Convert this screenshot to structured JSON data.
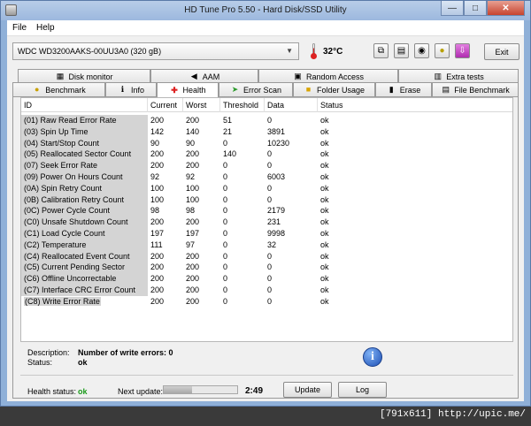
{
  "window": {
    "title": "HD Tune Pro 5.50 - Hard Disk/SSD Utility",
    "min_label": "—",
    "max_label": "□",
    "close_label": "✕"
  },
  "menu": [
    "File",
    "Help"
  ],
  "toolbar": {
    "drive": "WDC WD3200AAKS-00UU3A0 (320 gB)",
    "temperature": "32°C",
    "exit_label": "Exit",
    "icons": [
      "copy-icon",
      "save-icon",
      "camera-icon",
      "options-icon",
      "download-icon"
    ]
  },
  "tabs_top": [
    {
      "label": "Disk monitor",
      "icon": "disk-monitor-icon"
    },
    {
      "label": "AAM",
      "icon": "speaker-icon"
    },
    {
      "label": "Random Access",
      "icon": "random-access-icon"
    },
    {
      "label": "Extra tests",
      "icon": "extra-tests-icon"
    }
  ],
  "tabs_bottom": [
    {
      "label": "Benchmark",
      "icon": "benchmark-icon"
    },
    {
      "label": "Info",
      "icon": "info-tab-icon"
    },
    {
      "label": "Health",
      "icon": "health-icon"
    },
    {
      "label": "Error Scan",
      "icon": "error-scan-icon"
    },
    {
      "label": "Folder Usage",
      "icon": "folder-icon"
    },
    {
      "label": "Erase",
      "icon": "erase-icon"
    },
    {
      "label": "File Benchmark",
      "icon": "file-benchmark-icon"
    }
  ],
  "active_tab": "Health",
  "table": {
    "headers": [
      "ID",
      "Current",
      "Worst",
      "Threshold",
      "Data",
      "Status"
    ],
    "rows": [
      [
        "(01) Raw Read Error Rate",
        "200",
        "200",
        "51",
        "0",
        "ok"
      ],
      [
        "(03) Spin Up Time",
        "142",
        "140",
        "21",
        "3891",
        "ok"
      ],
      [
        "(04) Start/Stop Count",
        "90",
        "90",
        "0",
        "10230",
        "ok"
      ],
      [
        "(05) Reallocated Sector Count",
        "200",
        "200",
        "140",
        "0",
        "ok"
      ],
      [
        "(07) Seek Error Rate",
        "200",
        "200",
        "0",
        "0",
        "ok"
      ],
      [
        "(09) Power On Hours Count",
        "92",
        "92",
        "0",
        "6003",
        "ok"
      ],
      [
        "(0A) Spin Retry Count",
        "100",
        "100",
        "0",
        "0",
        "ok"
      ],
      [
        "(0B) Calibration Retry Count",
        "100",
        "100",
        "0",
        "0",
        "ok"
      ],
      [
        "(0C) Power Cycle Count",
        "98",
        "98",
        "0",
        "2179",
        "ok"
      ],
      [
        "(C0) Unsafe Shutdown Count",
        "200",
        "200",
        "0",
        "231",
        "ok"
      ],
      [
        "(C1) Load Cycle Count",
        "197",
        "197",
        "0",
        "9998",
        "ok"
      ],
      [
        "(C2) Temperature",
        "111",
        "97",
        "0",
        "32",
        "ok"
      ],
      [
        "(C4) Reallocated Event Count",
        "200",
        "200",
        "0",
        "0",
        "ok"
      ],
      [
        "(C5) Current Pending Sector",
        "200",
        "200",
        "0",
        "0",
        "ok"
      ],
      [
        "(C6) Offline Uncorrectable",
        "200",
        "200",
        "0",
        "0",
        "ok"
      ],
      [
        "(C7) Interface CRC Error Count",
        "200",
        "200",
        "0",
        "0",
        "ok"
      ],
      [
        "(C8) Write Error Rate",
        "200",
        "200",
        "0",
        "0",
        "ok"
      ]
    ]
  },
  "description": {
    "desc_label": "Description:",
    "desc_value": "Number of write errors: 0",
    "status_label": "Status:",
    "status_value": "ok"
  },
  "health": {
    "status_label": "Health status:",
    "status_value": "ok",
    "next_update_label": "Next update:",
    "progress": 0.38,
    "timer": "2:49",
    "update_label": "Update",
    "log_label": "Log"
  },
  "watermark": "[791x611] http://upic.me/",
  "colors": {
    "health_ok": "#1a9a1a",
    "title_bar": "#9cb8de",
    "id_cell_bg": "#d4d4d4"
  }
}
